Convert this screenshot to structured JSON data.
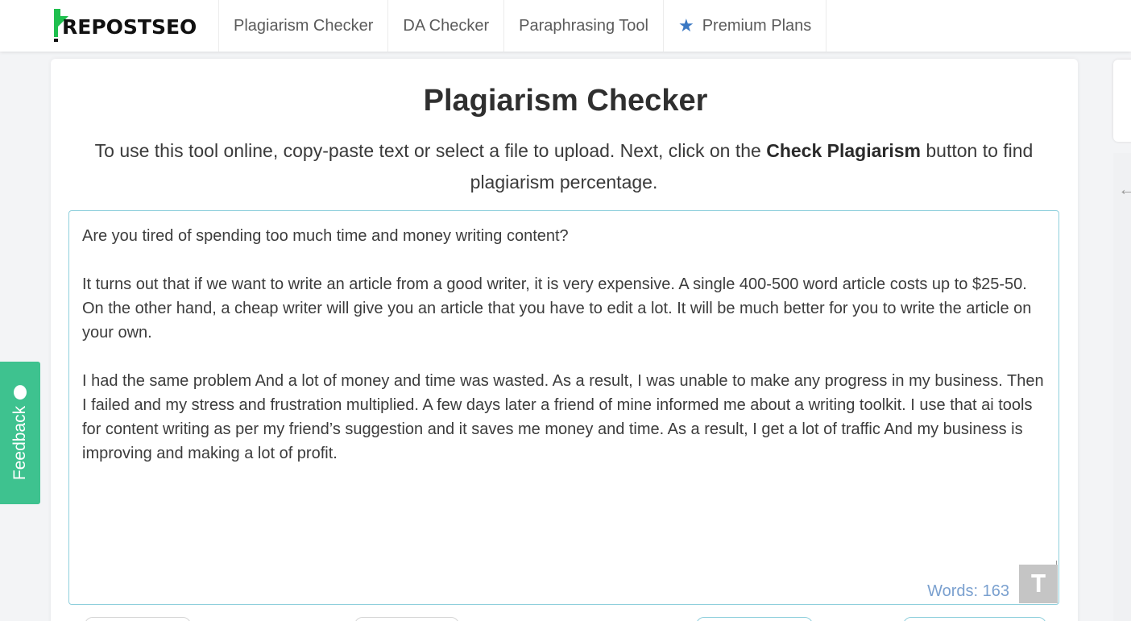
{
  "brand": {
    "logo_text": "REPOSTSEO",
    "logo_color": "#1fbf4e"
  },
  "nav": {
    "items": [
      {
        "label": "Plagiarism Checker"
      },
      {
        "label": "DA Checker"
      },
      {
        "label": "Paraphrasing Tool"
      },
      {
        "label": "Premium Plans",
        "icon": "star-icon"
      }
    ]
  },
  "main": {
    "title": "Plagiarism Checker",
    "desc_before": "To use this tool online, copy-paste text or select a file to upload. Next, click on the ",
    "desc_bold": "Check Plagiarism",
    "desc_after": " button to find plagiarism percentage."
  },
  "editor": {
    "paragraphs": [
      "Are you tired of spending too much time and money writing content?",
      "It turns out that if we want to write an article from a good writer, it is very expensive. A single 400-500 word article costs up to $25-50. On the other hand, a cheap writer will give you an article that you have to edit a lot. It will be much better for you to write the article on your own.",
      "I had the same problem And a lot of money and time was wasted. As a result, I was unable to make any progress in my business. Then I failed and my stress and frustration multiplied. A few days later a friend of mine informed me about a writing toolkit. I use that ai tools for content writing as per my friend’s suggestion and it saves me money and time. As a result, I get a lot of traffic And my business is improving and making a lot of profit."
    ],
    "word_count": "Words: 163",
    "translate_icon": "translate-icon"
  },
  "feedback": {
    "label": "Feedback",
    "color": "#3ec28f"
  },
  "colors": {
    "accent": "#3a78c3",
    "editor_border": "#8fcfdc",
    "word_count": "#7aa0cf"
  }
}
